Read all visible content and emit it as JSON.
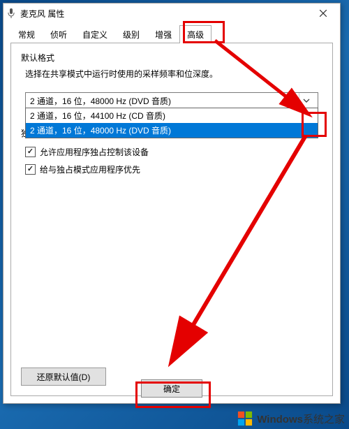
{
  "window": {
    "title": "麦克风 属性"
  },
  "tabs": {
    "t0": "常规",
    "t1": "侦听",
    "t2": "自定义",
    "t3": "级别",
    "t4": "增强",
    "t5": "高级"
  },
  "group_default": {
    "label": "默认格式",
    "desc": "选择在共享模式中运行时使用的采样频率和位深度。"
  },
  "select": {
    "current": "2 通道，16 位，48000 Hz (DVD 音质)",
    "opt0": "2 通道，16 位，44100 Hz (CD 音质)",
    "opt1": "2 通道，16 位，48000 Hz (DVD 音质)"
  },
  "group_exclusive": {
    "label": "独占模式",
    "chk0": "允许应用程序独占控制该设备",
    "chk1": "给与独占模式应用程序优先"
  },
  "buttons": {
    "restore": "还原默认值(D)",
    "ok": "确定"
  },
  "watermark": {
    "brand": "Windows",
    "site": "系统之家"
  }
}
